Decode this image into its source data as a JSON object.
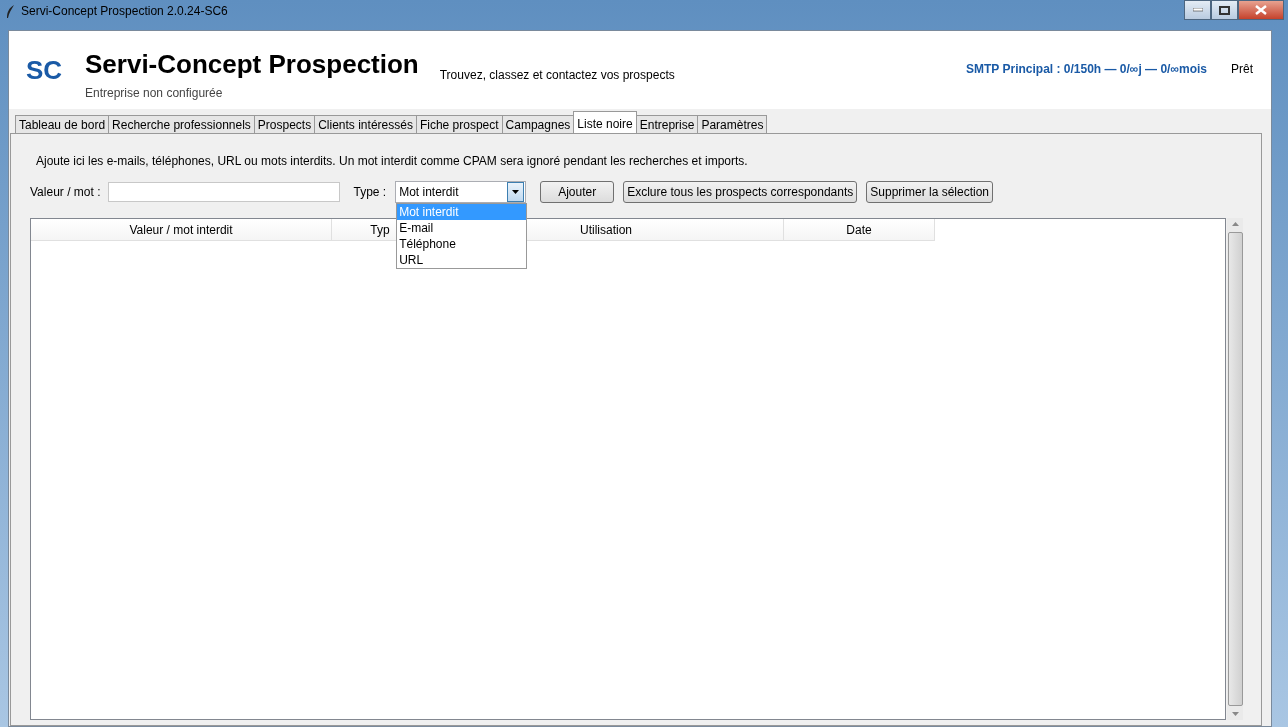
{
  "window": {
    "title": "Servi-Concept Prospection 2.0.24-SC6"
  },
  "header": {
    "logo": "SC",
    "title": "Servi-Concept Prospection",
    "subtitle": "Entreprise non configurée",
    "tagline": "Trouvez, classez et contactez vos prospects",
    "smtp": "SMTP Principal : 0/150h — 0/∞j — 0/∞mois",
    "status": "Prêt"
  },
  "tabs": [
    {
      "label": "Tableau de bord",
      "selected": false
    },
    {
      "label": "Recherche professionnels",
      "selected": false
    },
    {
      "label": "Prospects",
      "selected": false
    },
    {
      "label": "Clients intéressés",
      "selected": false
    },
    {
      "label": "Fiche prospect",
      "selected": false
    },
    {
      "label": "Campagnes",
      "selected": false
    },
    {
      "label": "Liste noire",
      "selected": true
    },
    {
      "label": "Entreprise",
      "selected": false
    },
    {
      "label": "Paramètres",
      "selected": false
    }
  ],
  "panel": {
    "hint": "Ajoute ici les e-mails, téléphones, URL ou mots interdits. Un mot interdit comme CPAM sera ignoré pendant les recherches et imports.",
    "value_label": "Valeur / mot :",
    "type_label": "Type :",
    "type_value": "Mot interdit",
    "dropdown": {
      "expanded": true,
      "options": [
        {
          "label": "Mot interdit",
          "selected": true
        },
        {
          "label": "E-mail",
          "selected": false
        },
        {
          "label": "Téléphone",
          "selected": false
        },
        {
          "label": "URL",
          "selected": false
        }
      ]
    },
    "buttons": [
      "Ajouter",
      "Exclure tous les prospects correspondants",
      "Supprimer la sélection"
    ]
  },
  "table": {
    "columns": [
      "Valeur / mot interdit",
      "Typ",
      "Utilisation",
      "Date"
    ]
  }
}
